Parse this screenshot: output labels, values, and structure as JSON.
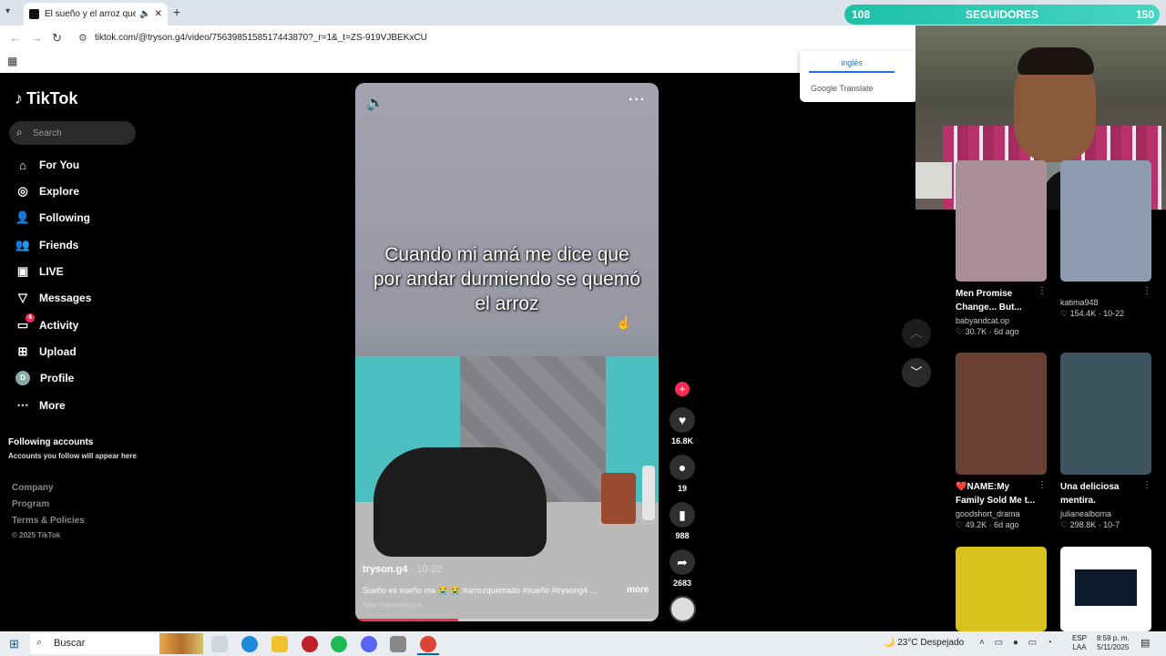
{
  "browser": {
    "tab_title": "El sueño y el arroz quemado",
    "url": "tiktok.com/@tryson.g4/video/7563985158517443870?_r=1&_t=ZS-919VJBEKxCU"
  },
  "translate_popup": {
    "language": "inglés",
    "brand": "Google Translate"
  },
  "overlay": {
    "left_count": "108",
    "label": "SEGUIDORES",
    "right_count": "150"
  },
  "sidebar": {
    "logo": "TikTok",
    "search_placeholder": "Search",
    "items": [
      {
        "label": "For You",
        "icon": "home-icon"
      },
      {
        "label": "Explore",
        "icon": "compass-icon"
      },
      {
        "label": "Following",
        "icon": "following-icon"
      },
      {
        "label": "Friends",
        "icon": "friends-icon"
      },
      {
        "label": "LIVE",
        "icon": "live-icon"
      },
      {
        "label": "Messages",
        "icon": "messages-icon"
      },
      {
        "label": "Activity",
        "icon": "activity-icon",
        "badge": "4"
      },
      {
        "label": "Upload",
        "icon": "upload-icon"
      },
      {
        "label": "Profile",
        "icon": "avatar",
        "avatar_letter": "D"
      },
      {
        "label": "More",
        "icon": "more-icon"
      }
    ],
    "following_heading": "Following accounts",
    "following_sub": "Accounts you follow will appear here",
    "footer": [
      "Company",
      "Program",
      "Terms & Policies",
      "© 2025 TikTok"
    ]
  },
  "video": {
    "caption": "Cuando mi amá me dice que por andar durmiendo se quemó el arroz",
    "author": "tryson.g4",
    "date": "10-22",
    "description": "Sueño es sueño ma 😭 😭 #arrozquemado #sueño #trysong4 ...",
    "more_label": "more",
    "see_translation": "See translation",
    "progress": 0.34
  },
  "actions": {
    "likes": "16.8K",
    "comments": "19",
    "saves": "988",
    "shares": "2683"
  },
  "related": [
    {
      "title": "Men Promise Change... But...",
      "author": "babyandcat.op",
      "likes": "30.7K",
      "date": "6d ago",
      "thumb": "#a98f96"
    },
    {
      "title": "",
      "author": "katima948",
      "likes": "154.4K",
      "date": "10-22",
      "thumb": "#8c9bb0"
    },
    {
      "title": "❤️NAME:My Family Sold Me t...",
      "author": "goodshort_drama",
      "likes": "49.2K",
      "date": "6d ago",
      "thumb": "#6b4034"
    },
    {
      "title": "Una deliciosa mentira.",
      "author": "julianealborna",
      "likes": "298.8K",
      "date": "10-7",
      "thumb": "#3e5560"
    },
    {
      "title": "",
      "author": "",
      "likes": "",
      "date": "",
      "thumb": "#d8c21e"
    },
    {
      "title": "",
      "author": "",
      "likes": "",
      "date": "",
      "thumb": "#ffffff"
    }
  ],
  "taskbar": {
    "search_label": "Buscar",
    "weather": "23°C  Despejado",
    "lang_top": "ESP",
    "lang_bottom": "LAA",
    "time": "8:59 p. m.",
    "date": "5/11/2025"
  }
}
